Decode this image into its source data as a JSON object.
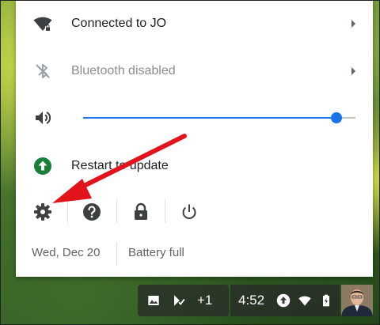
{
  "menu": {
    "network": {
      "label": "Connected to JO"
    },
    "bluetooth": {
      "label": "Bluetooth disabled"
    },
    "volume": {
      "level_fraction": 0.93
    },
    "update": {
      "label": "Restart to update"
    }
  },
  "footer": {
    "date": "Wed, Dec 20",
    "battery": "Battery full"
  },
  "shelf": {
    "notifications_more": "+1",
    "time": "4:52"
  },
  "colors": {
    "accent": "#1a73e8",
    "update_green": "#188038",
    "arrow_red": "#e1141c"
  },
  "icons": [
    "wifi-icon",
    "bluetooth-icon",
    "volume-icon",
    "update-icon",
    "settings-icon",
    "help-icon",
    "lock-icon",
    "power-icon",
    "image-icon",
    "download-check-icon",
    "upload-icon",
    "battery-icon"
  ]
}
